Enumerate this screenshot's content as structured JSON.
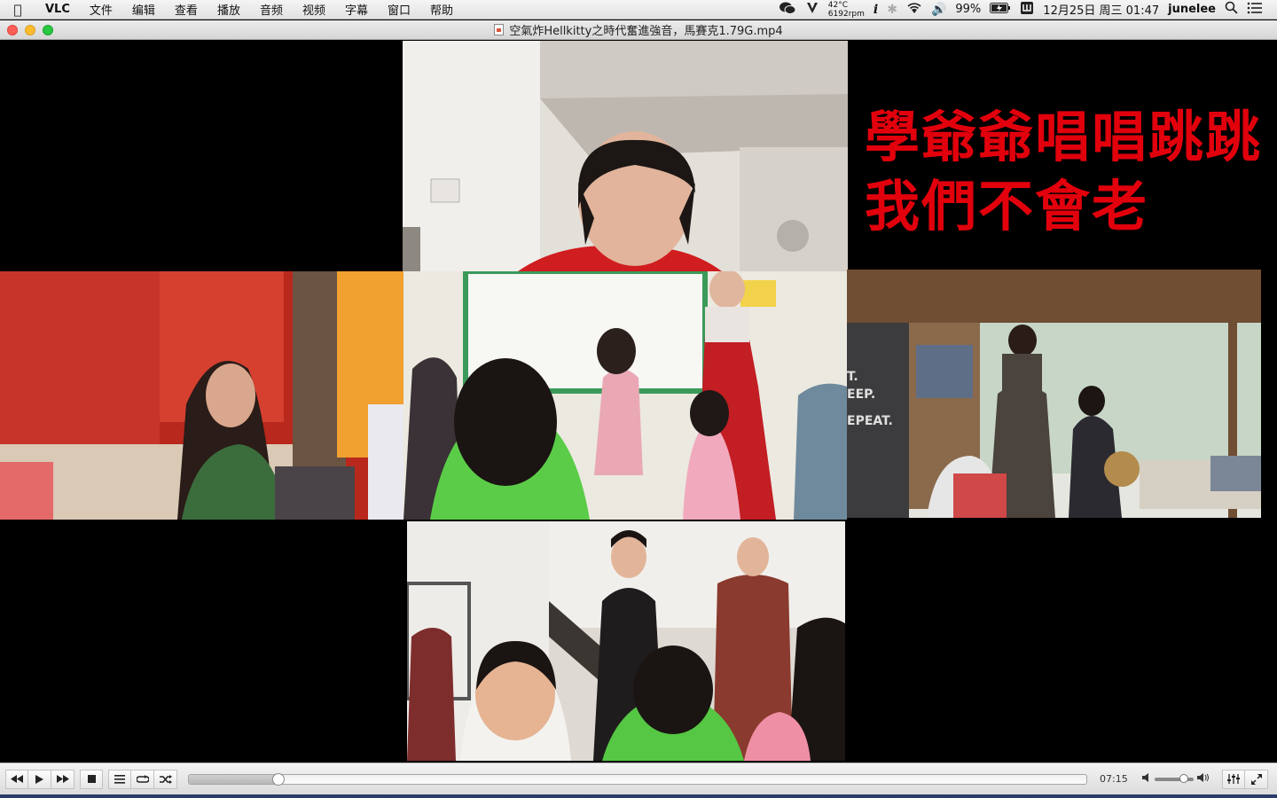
{
  "menubar": {
    "apple": "",
    "items": [
      "VLC",
      "文件",
      "编辑",
      "查看",
      "播放",
      "音频",
      "视频",
      "字幕",
      "窗口",
      "帮助"
    ],
    "status": {
      "temperature": "42°C",
      "fan": "6192rpm",
      "battery": "99%",
      "datetime": "12月25日 周三  01:47",
      "user": "junelee"
    }
  },
  "window": {
    "title": "空氣炸Hellkitty之時代奮進強音，馬賽克1.79G.mp4"
  },
  "video": {
    "caption_line1": "學爺爺唱唱跳跳",
    "caption_line2": "我們不會老"
  },
  "controls": {
    "elapsed": "07:15",
    "progress_fraction": 0.1,
    "volume_fraction": 0.75
  }
}
